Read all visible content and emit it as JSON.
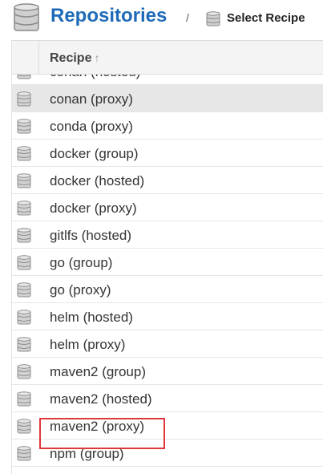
{
  "header": {
    "title": "Repositories",
    "separator": "/",
    "breadcrumb": "Select Recipe"
  },
  "table": {
    "column_header": "Recipe",
    "sort_indicator": "↑",
    "rows": [
      {
        "label": "conan (hosted)",
        "selected": false
      },
      {
        "label": "conan (proxy)",
        "selected": true
      },
      {
        "label": "conda (proxy)",
        "selected": false
      },
      {
        "label": "docker (group)",
        "selected": false
      },
      {
        "label": "docker (hosted)",
        "selected": false
      },
      {
        "label": "docker (proxy)",
        "selected": false
      },
      {
        "label": "gitlfs (hosted)",
        "selected": false
      },
      {
        "label": "go (group)",
        "selected": false
      },
      {
        "label": "go (proxy)",
        "selected": false
      },
      {
        "label": "helm (hosted)",
        "selected": false
      },
      {
        "label": "helm (proxy)",
        "selected": false
      },
      {
        "label": "maven2 (group)",
        "selected": false
      },
      {
        "label": "maven2 (hosted)",
        "selected": false
      },
      {
        "label": "maven2 (proxy)",
        "selected": false
      },
      {
        "label": "npm (group)",
        "selected": false
      }
    ]
  },
  "colors": {
    "title": "#1f6bb8",
    "selected_row": "#e7e7e7",
    "highlight": "#e0383a"
  },
  "icons": {
    "header": "database-icon",
    "row": "database-icon"
  }
}
